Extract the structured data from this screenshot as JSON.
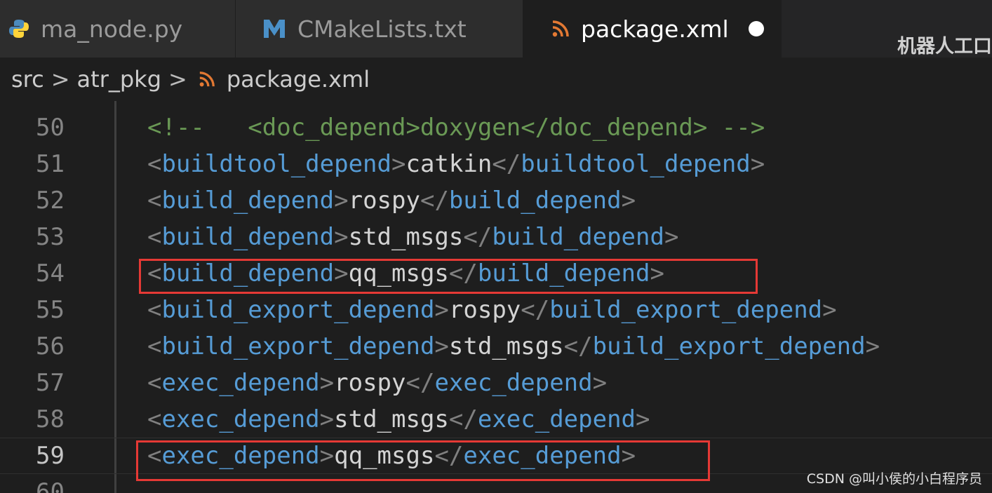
{
  "tabs": [
    {
      "label": "ma_node.py",
      "icon": "python-icon"
    },
    {
      "label": "CMakeLists.txt",
      "icon": "cmake-icon"
    },
    {
      "label": "package.xml",
      "icon": "rss-xml-icon",
      "modified": true
    }
  ],
  "watermark_top": "机器人工口",
  "breadcrumb": {
    "items": [
      "src",
      "atr_pkg",
      "package.xml"
    ],
    "separator": ">"
  },
  "lines": [
    {
      "num": "50",
      "text": [
        "<!--",
        "   <doc_depend>doxygen</doc_depend> -->"
      ]
    },
    {
      "num": "51",
      "open": "buildtool_depend",
      "value": "catkin"
    },
    {
      "num": "52",
      "open": "build_depend",
      "value": "rospy"
    },
    {
      "num": "53",
      "open": "build_depend",
      "value": "std_msgs"
    },
    {
      "num": "54",
      "open": "build_depend",
      "value": "qq_msgs"
    },
    {
      "num": "55",
      "open": "build_export_depend",
      "value": "rospy"
    },
    {
      "num": "56",
      "open": "build_export_depend",
      "value": "std_msgs"
    },
    {
      "num": "57",
      "open": "exec_depend",
      "value": "rospy"
    },
    {
      "num": "58",
      "open": "exec_depend",
      "value": "std_msgs"
    },
    {
      "num": "59",
      "open": "exec_depend",
      "value": "qq_msgs"
    },
    {
      "num": "60"
    }
  ],
  "colors": {
    "tag": "#569cd6",
    "bracket": "#808080",
    "text": "#d4d4d4",
    "comment": "#6a9955",
    "highlight_box": "#e53935"
  },
  "watermark_bottom": "CSDN @叫小侯的小白程序员"
}
